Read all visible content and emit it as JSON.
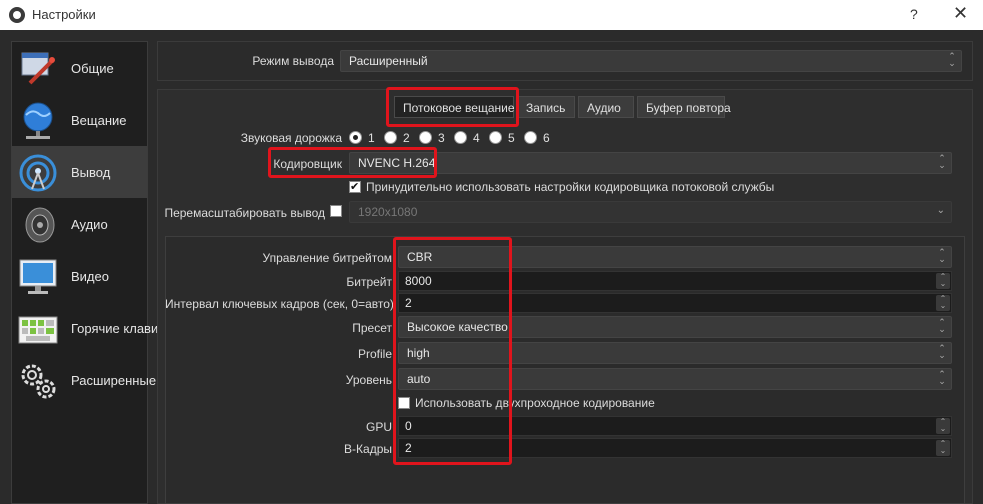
{
  "window": {
    "title": "Настройки",
    "help": "?",
    "close": "✕"
  },
  "sidebar": {
    "items": [
      {
        "label": "Общие",
        "icon": "general-settings-icon"
      },
      {
        "label": "Вещание",
        "icon": "globe-stream-icon"
      },
      {
        "label": "Вывод",
        "icon": "output-broadcast-icon",
        "selected": true
      },
      {
        "label": "Аудио",
        "icon": "speaker-icon"
      },
      {
        "label": "Видео",
        "icon": "monitor-icon"
      },
      {
        "label": "Горячие клави",
        "icon": "keyboard-icon"
      },
      {
        "label": "Расширенные",
        "icon": "gears-icon"
      }
    ]
  },
  "output_mode": {
    "label": "Режим вывода",
    "value": "Расширенный"
  },
  "tabs": [
    {
      "label": "Потоковое вещание",
      "active": true
    },
    {
      "label": "Запись"
    },
    {
      "label": "Аудио"
    },
    {
      "label": "Буфер повтора"
    }
  ],
  "audio_track": {
    "label": "Звуковая дорожка",
    "options": [
      "1",
      "2",
      "3",
      "4",
      "5",
      "6"
    ],
    "selected": "1"
  },
  "encoder": {
    "label": "Кодировщик",
    "value": "NVENC H.264"
  },
  "enforce_checkbox": {
    "label": "Принудительно использовать настройки кодировщика потоковой службы",
    "checked": true
  },
  "rescale": {
    "label": "Перемасштабировать вывод",
    "value": "1920x1080",
    "checked": false
  },
  "encoder_settings": {
    "rate_control": {
      "label": "Управление битрейтом",
      "value": "CBR"
    },
    "bitrate": {
      "label": "Битрейт",
      "value": "8000"
    },
    "keyframe": {
      "label": "Интервал ключевых кадров (сек, 0=авто)",
      "value": "2"
    },
    "preset": {
      "label": "Пресет",
      "value": "Высокое качество"
    },
    "profile": {
      "label": "Profile",
      "value": "high"
    },
    "level": {
      "label": "Уровень",
      "value": "auto"
    },
    "two_pass": {
      "label": "Использовать двухпроходное кодирование",
      "checked": false
    },
    "gpu": {
      "label": "GPU",
      "value": "0"
    },
    "bframes": {
      "label": "B-Кадры",
      "value": "2"
    }
  },
  "colors": {
    "highlight": "#e0141c",
    "background": "#2b2b2b",
    "sidebar": "#1f1f1f"
  }
}
